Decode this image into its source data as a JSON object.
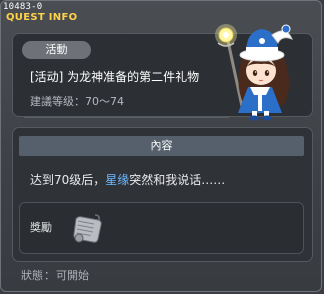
{
  "header": {
    "quest_id": "10483-0",
    "title": "QUEST INFO"
  },
  "quest": {
    "category_badge": "活動",
    "name": "[活动] 为龙神准备的第二件礼物",
    "level_label": "建議等级：",
    "level_range": "70～74"
  },
  "content": {
    "header": "內容",
    "text_before": "达到70级后，",
    "text_highlight": "星缘",
    "text_after": "突然和我说话……",
    "highlight_color": "#6fb9ff"
  },
  "reward": {
    "label": "獎勵",
    "item_icon": "scroll-icon"
  },
  "status": {
    "label": "狀態",
    "separator": "：",
    "value": "可開始"
  },
  "colors": {
    "title": "#ffd24a",
    "background": "#3a3d42"
  }
}
